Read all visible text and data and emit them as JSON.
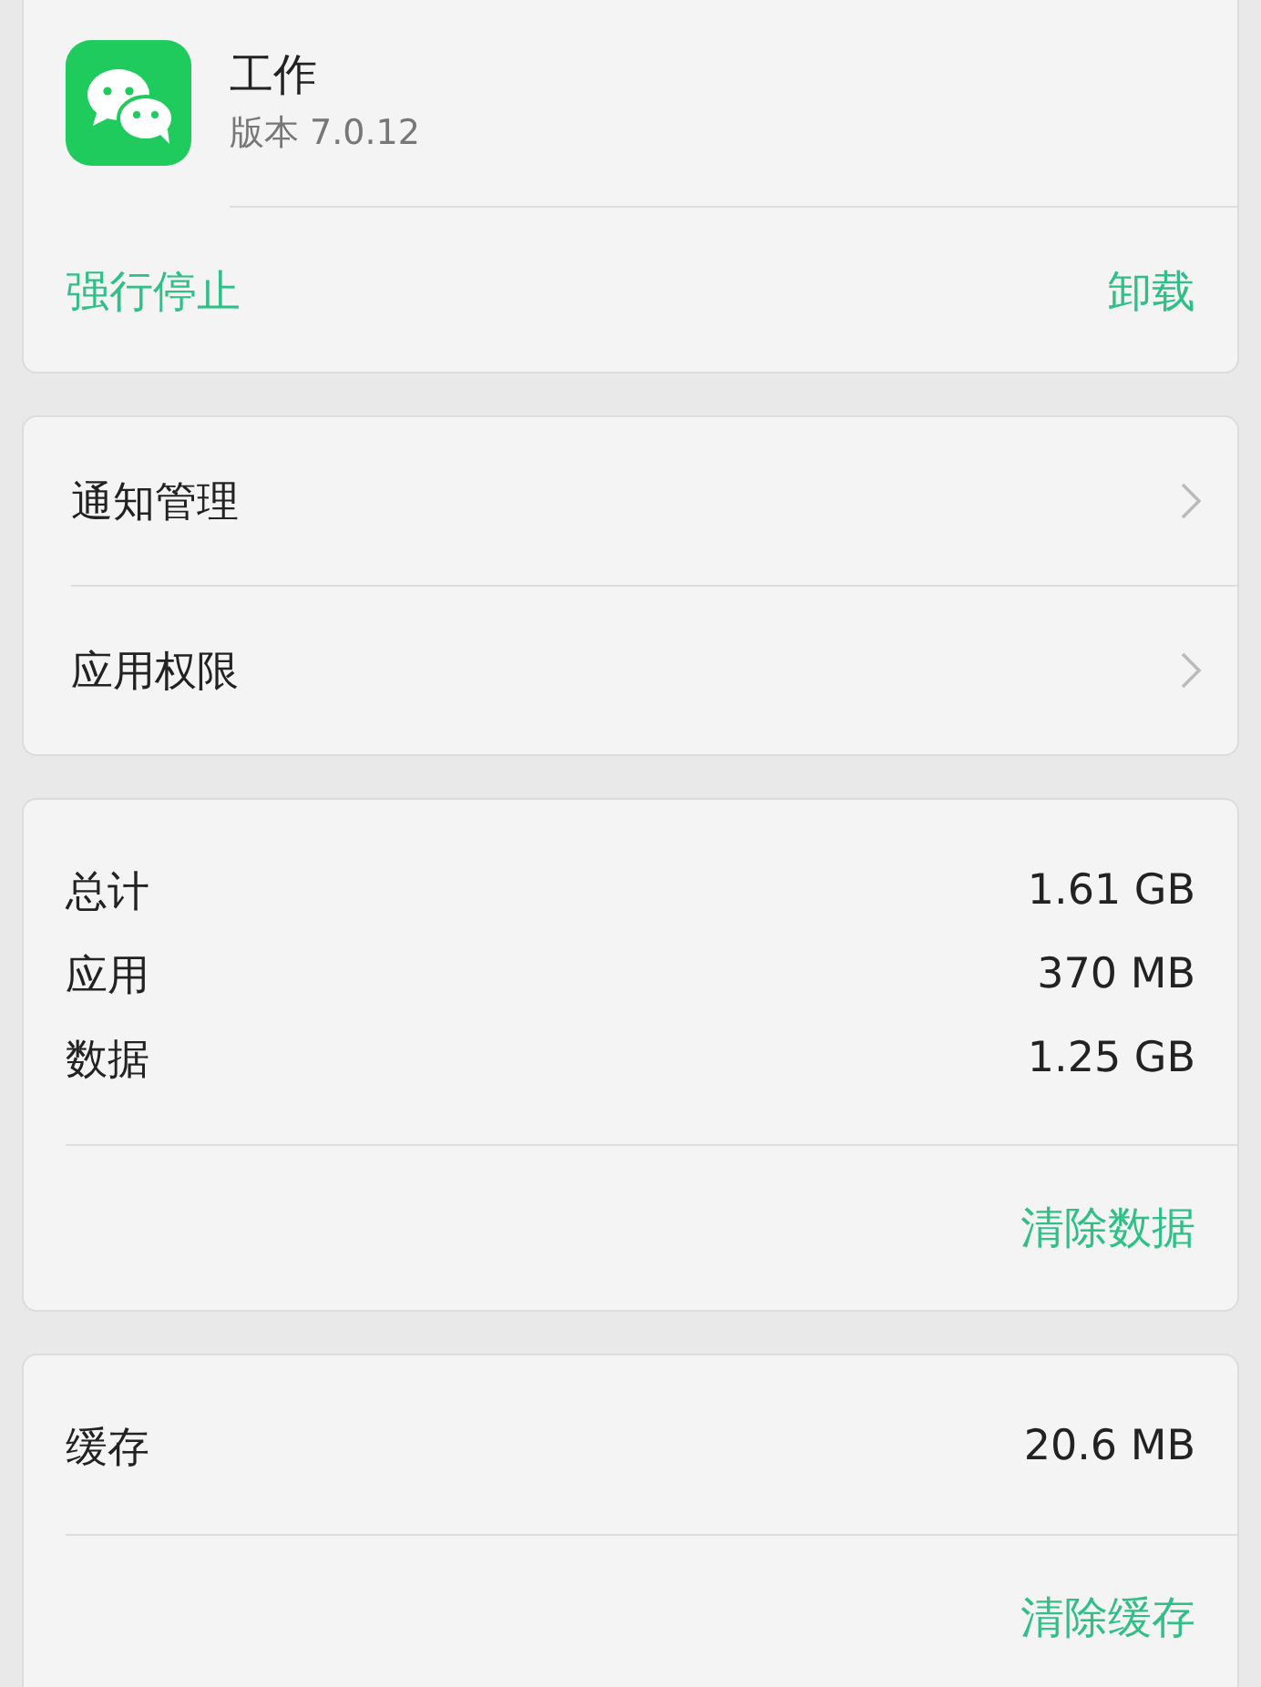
{
  "app": {
    "name": "工作",
    "version": "版本 7.0.12"
  },
  "app_actions": [
    {
      "label": "强行停止"
    },
    {
      "label": "卸载"
    }
  ],
  "menu": [
    {
      "label": "通知管理"
    },
    {
      "label": "应用权限"
    }
  ],
  "storage": {
    "rows": [
      {
        "label": "总计",
        "value": "1.61 GB"
      },
      {
        "label": "应用",
        "value": "370 MB"
      },
      {
        "label": "数据",
        "value": "1.25 GB"
      }
    ],
    "action": "清除数据"
  },
  "cache": {
    "rows": [
      {
        "label": "缓存",
        "value": "20.6 MB"
      }
    ],
    "action": "清除缓存"
  }
}
